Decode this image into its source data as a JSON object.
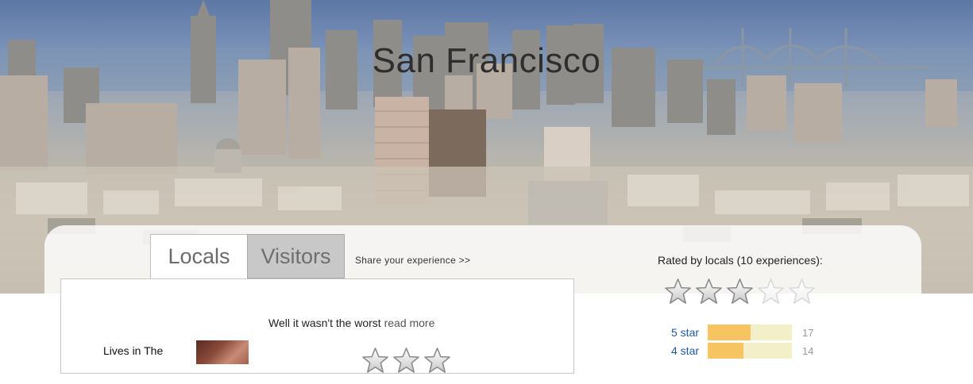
{
  "hero": {
    "title": "San Francisco"
  },
  "tabs": [
    {
      "label": "Locals",
      "active": true
    },
    {
      "label": "Visitors",
      "active": false
    }
  ],
  "share_link": "Share your experience >>",
  "review": {
    "title": "Well it wasn't the worst",
    "read_more": "read more",
    "reviewer_location": "Lives in The",
    "stars_visible": 3
  },
  "rating_summary": {
    "label": "Rated by locals (10 experiences):",
    "average_stars": 3,
    "max_stars": 5,
    "breakdown": [
      {
        "label": "5 star",
        "count": "17",
        "fraction": 0.51
      },
      {
        "label": "4 star",
        "count": "14",
        "fraction": 0.42
      }
    ]
  },
  "colors": {
    "tab_active_bg": "#ffffff",
    "tab_inactive_bg": "#c8c8c8",
    "bar_fill": "#f6c562",
    "bar_track": "#f3f0c9",
    "link_blue": "#1f5aa0"
  }
}
